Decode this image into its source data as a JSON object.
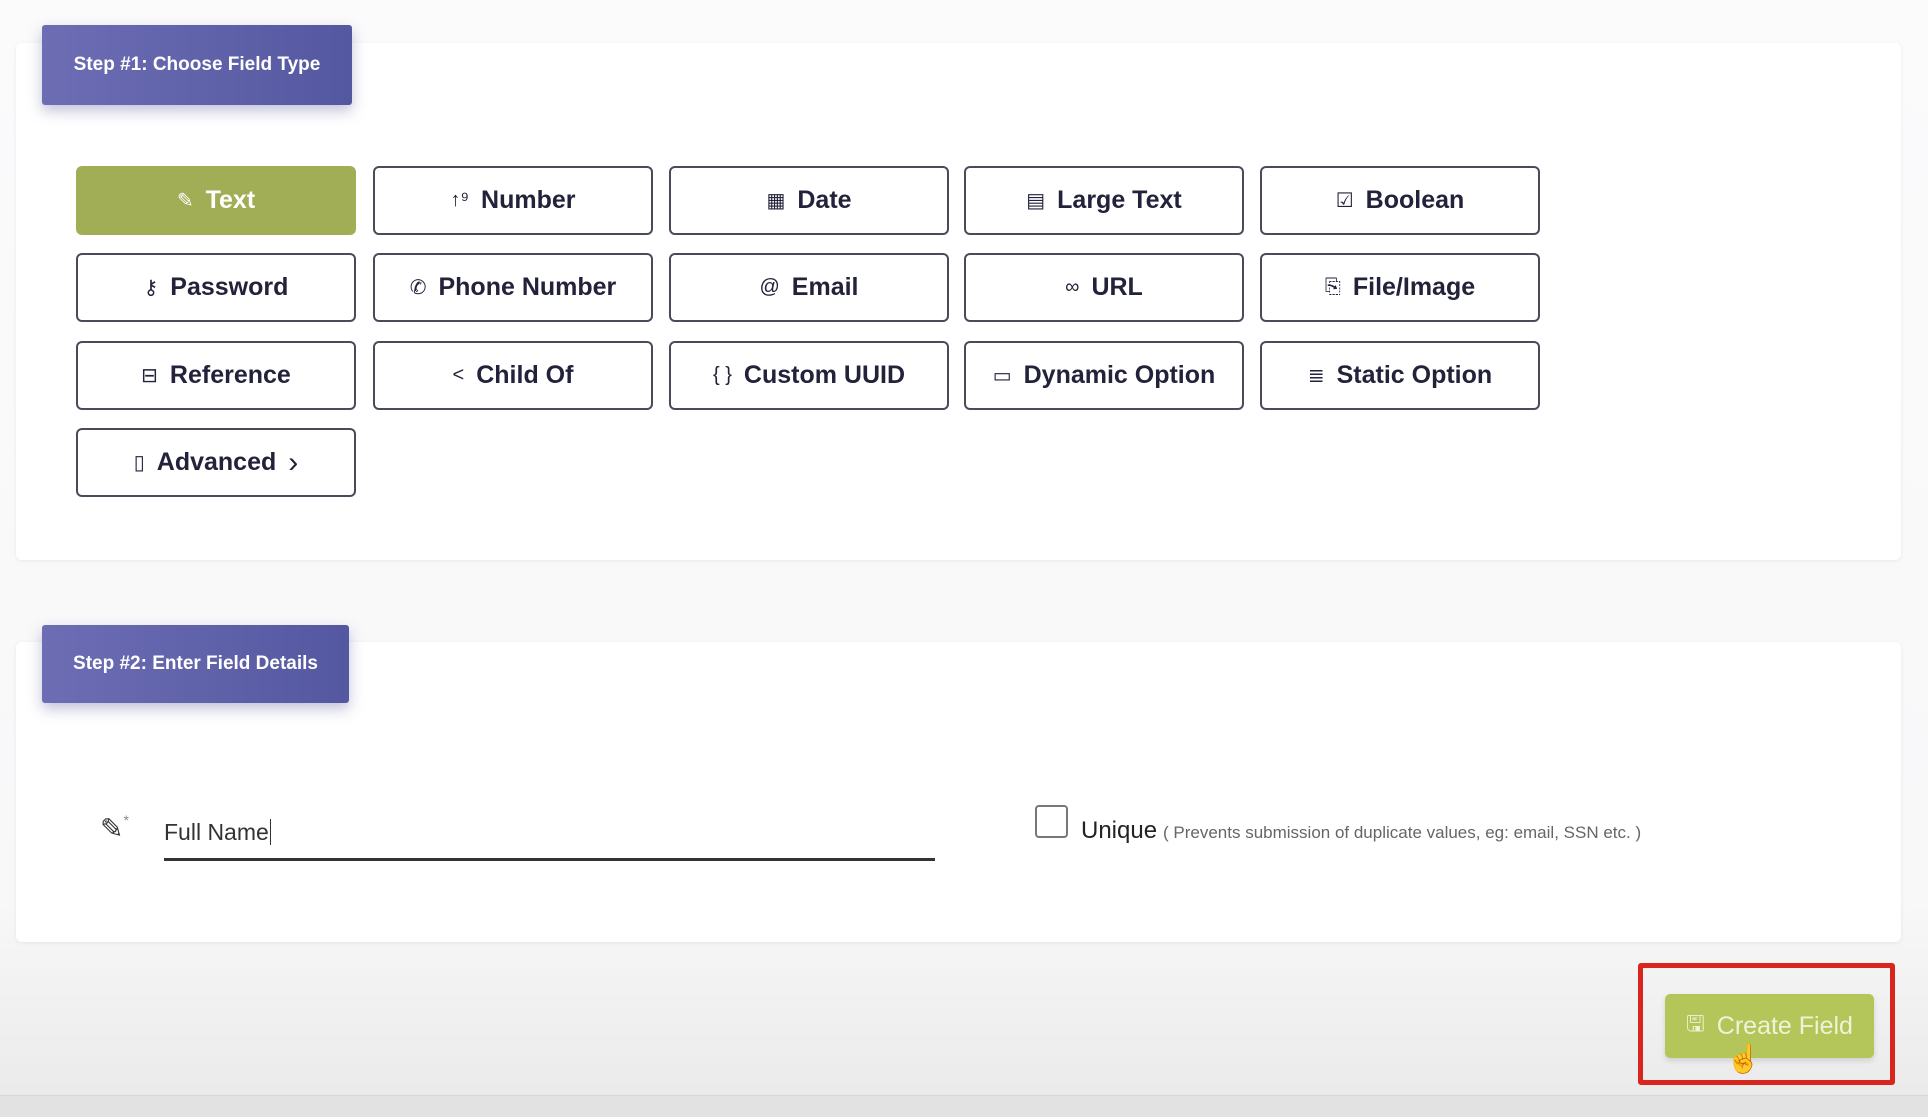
{
  "step1": {
    "title": "Step #1: Choose Field Type",
    "field_types": [
      {
        "label": "Text",
        "icon": "✎",
        "icon_name": "pencil-icon",
        "active": true
      },
      {
        "label": "Number",
        "icon": "↑⁹",
        "icon_name": "number-sort-icon"
      },
      {
        "label": "Date",
        "icon": "▦",
        "icon_name": "calendar-icon"
      },
      {
        "label": "Large Text",
        "icon": "▤",
        "icon_name": "newspaper-icon"
      },
      {
        "label": "Boolean",
        "icon": "☑",
        "icon_name": "checkbox-icon"
      },
      {
        "label": "Password",
        "icon": "⚷",
        "icon_name": "key-icon"
      },
      {
        "label": "Phone Number",
        "icon": "✆",
        "icon_name": "phone-icon"
      },
      {
        "label": "Email",
        "icon": "@",
        "icon_name": "at-icon"
      },
      {
        "label": "URL",
        "icon": "∞",
        "icon_name": "link-icon"
      },
      {
        "label": "File/Image",
        "icon": "⎘",
        "icon_name": "paperclip-icon"
      },
      {
        "label": "Reference",
        "icon": "⊟",
        "icon_name": "archive-icon"
      },
      {
        "label": "Child Of",
        "icon": "<",
        "icon_name": "share-icon"
      },
      {
        "label": "Custom UUID",
        "icon": "{ }",
        "icon_name": "braces-icon"
      },
      {
        "label": "Dynamic Option",
        "icon": "▭",
        "icon_name": "folder-icon"
      },
      {
        "label": "Static Option",
        "icon": "≣",
        "icon_name": "list-icon"
      },
      {
        "label": "Advanced",
        "icon": "▯",
        "icon_name": "document-icon",
        "suffix": "›"
      }
    ]
  },
  "step2": {
    "title": "Step #2: Enter Field Details",
    "field_name_value": "Full Name",
    "required_mark": "*",
    "unique_label": "Unique",
    "unique_hint": "( Prevents submission of duplicate values, eg: email, SSN etc. )",
    "unique_checked": false
  },
  "create_button": {
    "label": "Create Field",
    "color": "#b4c65a",
    "highlight_color": "#d8261f"
  },
  "colors": {
    "accent_green": "#a2ae55",
    "badge_purple": "#5f62aa"
  }
}
